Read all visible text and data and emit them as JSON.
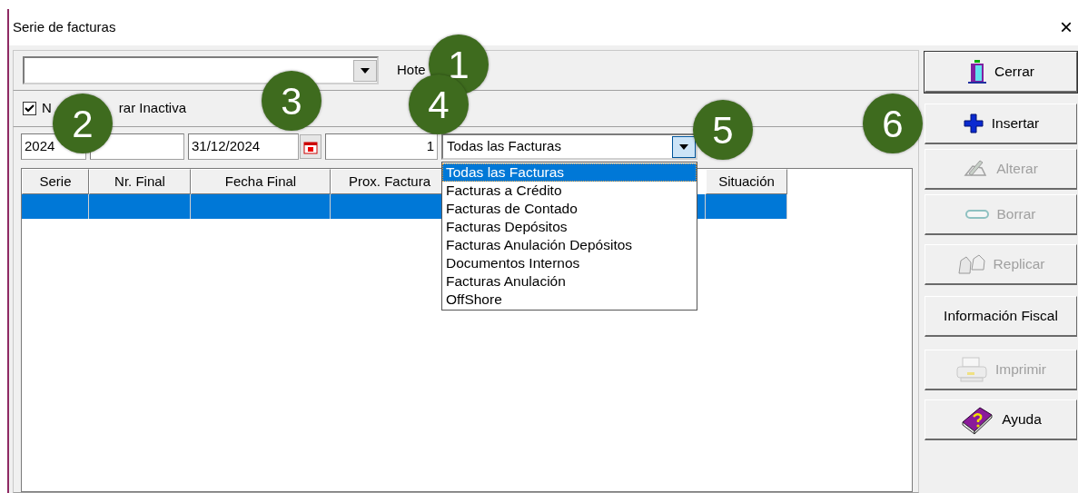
{
  "window": {
    "title": "Serie de facturas",
    "close": "×"
  },
  "hotel_combo": {
    "label": "Hote"
  },
  "inactive_checkbox": {
    "checked": true,
    "label_parts": [
      "N",
      "rar Inactiva"
    ]
  },
  "filters": [
    {
      "kind": "text",
      "value": "2024"
    },
    {
      "kind": "text"
    },
    {
      "kind": "date",
      "value": "31/12/2024"
    },
    {
      "kind": "number",
      "value": "1"
    },
    {
      "kind": "combo",
      "value": "Todas las Facturas",
      "expanded": true
    }
  ],
  "dropdown": {
    "options": [
      {
        "label": "Todas las Facturas",
        "selected": true
      },
      {
        "label": "Facturas a Crédito",
        "selected": false
      },
      {
        "label": "Facturas de Contado",
        "selected": false
      },
      {
        "label": "Facturas Depósitos",
        "selected": false
      },
      {
        "label": "Facturas Anulación Depósitos",
        "selected": false
      },
      {
        "label": "Documentos Internos",
        "selected": false
      },
      {
        "label": "Facturas Anulación",
        "selected": false
      },
      {
        "label": "OffShore",
        "selected": false
      }
    ]
  },
  "table": {
    "columns": [
      "Serie",
      "Nr. Final",
      "Fecha Final",
      "Prox. Factura",
      "Situación"
    ],
    "rows": [
      {
        "selected": true
      }
    ]
  },
  "buttons": [
    {
      "label": "Cerrar",
      "kind": "door",
      "disabled": false
    },
    {
      "label": "Insertar",
      "kind": "plus",
      "disabled": false
    },
    {
      "label": "Alterar",
      "kind": "pen",
      "disabled": true
    },
    {
      "label": "Borrar",
      "kind": "minus",
      "disabled": true
    },
    {
      "label": "Replicar",
      "kind": "copy",
      "disabled": true
    },
    {
      "label": "Información Fiscal",
      "kind": "text",
      "disabled": false
    },
    {
      "label": "Imprimir",
      "kind": "printer",
      "disabled": true
    },
    {
      "label": "Ayuda",
      "kind": "book",
      "disabled": false
    }
  ],
  "callouts": [
    "1",
    "2",
    "3",
    "4",
    "5",
    "6"
  ]
}
